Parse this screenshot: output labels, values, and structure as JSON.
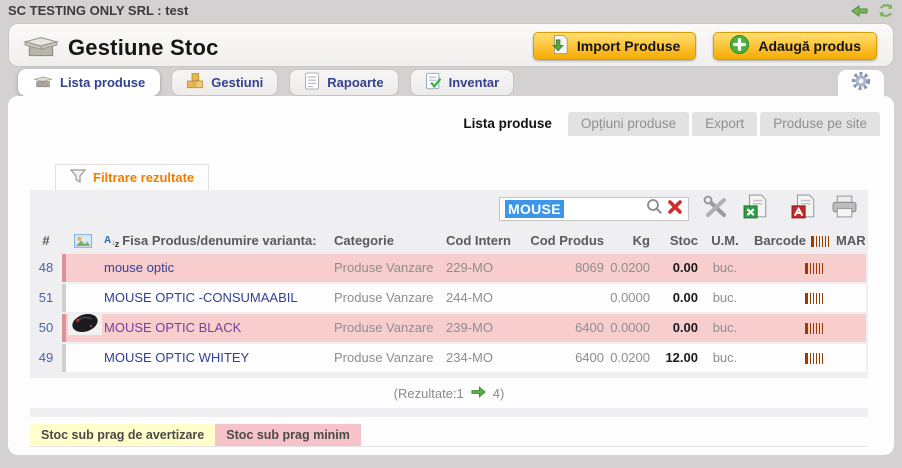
{
  "topbar": {
    "company": "SC TESTING ONLY SRL : test"
  },
  "header": {
    "title": "Gestiune Stoc",
    "import_label": "Import Produse",
    "add_label": "Adaugă produs"
  },
  "main_tabs": {
    "lista": "Lista produse",
    "gestiuni": "Gestiuni",
    "rapoarte": "Rapoarte",
    "inventar": "Inventar"
  },
  "sub_tabs": {
    "lista": "Lista produse",
    "optiuni": "Opțiuni produse",
    "export": "Export",
    "site": "Produse pe site"
  },
  "filter_label": "Filtrare rezultate",
  "search": {
    "value": "MOUSE"
  },
  "table": {
    "headers": {
      "num": "#",
      "name": "Fisa Produs/denumire varianta:",
      "category": "Categorie",
      "cod_intern": "Cod Intern",
      "cod_produs": "Cod Produs",
      "kg": "Kg",
      "stoc": "Stoc",
      "um": "U.M.",
      "barcode": "Barcode",
      "mar": "MAR"
    },
    "rows": [
      {
        "num": "48",
        "name": "mouse optic",
        "category": "Produse Vanzare",
        "cod_intern": "229-MO",
        "cod_produs": "8069",
        "kg": "0.0200",
        "stoc": "0.00",
        "um": "buc."
      },
      {
        "num": "51",
        "name": "MOUSE OPTIC -CONSUMAABIL",
        "category": "Produse Vanzare",
        "cod_intern": "244-MO",
        "cod_produs": "",
        "kg": "0.0000",
        "stoc": "0.00",
        "um": "buc."
      },
      {
        "num": "50",
        "name": "MOUSE OPTIC BLACK",
        "category": "Produse Vanzare",
        "cod_intern": "239-MO",
        "cod_produs": "6400",
        "kg": "0.0000",
        "stoc": "0.00",
        "um": "buc."
      },
      {
        "num": "49",
        "name": "MOUSE OPTIC WHITEY",
        "category": "Produse Vanzare",
        "cod_intern": "234-MO",
        "cod_produs": "6400",
        "kg": "0.0200",
        "stoc": "12.00",
        "um": "buc."
      }
    ],
    "results_prefix": "(Rezultate:1",
    "results_suffix": "4)"
  },
  "legend": {
    "warning": "Stoc sub prag de avertizare",
    "minimum": "Stoc sub prag minim"
  },
  "colors": {
    "row_warning_bg": "#ffffcc",
    "row_minimum_bg": "#f8cdce",
    "button_yellow": "#f5ad05",
    "selection_blue": "#3d96e8",
    "filter_orange": "#f07d00",
    "barcode_brown": "#9a3b00"
  }
}
